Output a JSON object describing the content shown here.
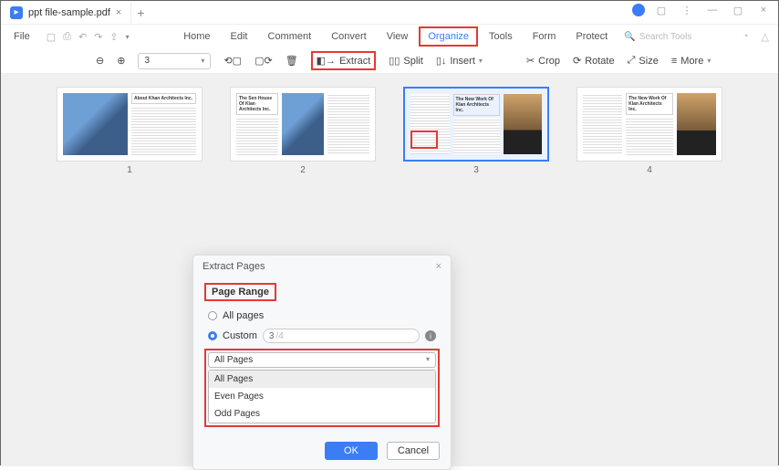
{
  "tab": {
    "title": "ppt file-sample.pdf"
  },
  "menu": {
    "file": "File",
    "home": "Home",
    "edit": "Edit",
    "comment": "Comment",
    "convert": "Convert",
    "view": "View",
    "organize": "Organize",
    "tools": "Tools",
    "form": "Form",
    "protect": "Protect",
    "search": "Search Tools"
  },
  "toolbar": {
    "page_field": "3",
    "extract": "Extract",
    "split": "Split",
    "insert": "Insert",
    "crop": "Crop",
    "rotate": "Rotate",
    "size": "Size",
    "more": "More"
  },
  "thumbs": {
    "p1": {
      "num": "1",
      "title": "About Khan Architects Inc."
    },
    "p2": {
      "num": "2",
      "title": "The Sen House Of Klan Architects Inc."
    },
    "p3": {
      "num": "3",
      "title": "The New Work Of Klan Architects Inc."
    },
    "p4": {
      "num": "4",
      "title": "The New Work Of Klan Architects Inc."
    }
  },
  "dialog": {
    "title": "Extract Pages",
    "page_range": "Page Range",
    "all_pages": "All pages",
    "custom": "Custom",
    "custom_val": "3",
    "custom_hint": "/4",
    "select_value": "All Pages",
    "options": {
      "o1": "All Pages",
      "o2": "Even Pages",
      "o3": "Odd Pages"
    },
    "ok": "OK",
    "cancel": "Cancel"
  }
}
